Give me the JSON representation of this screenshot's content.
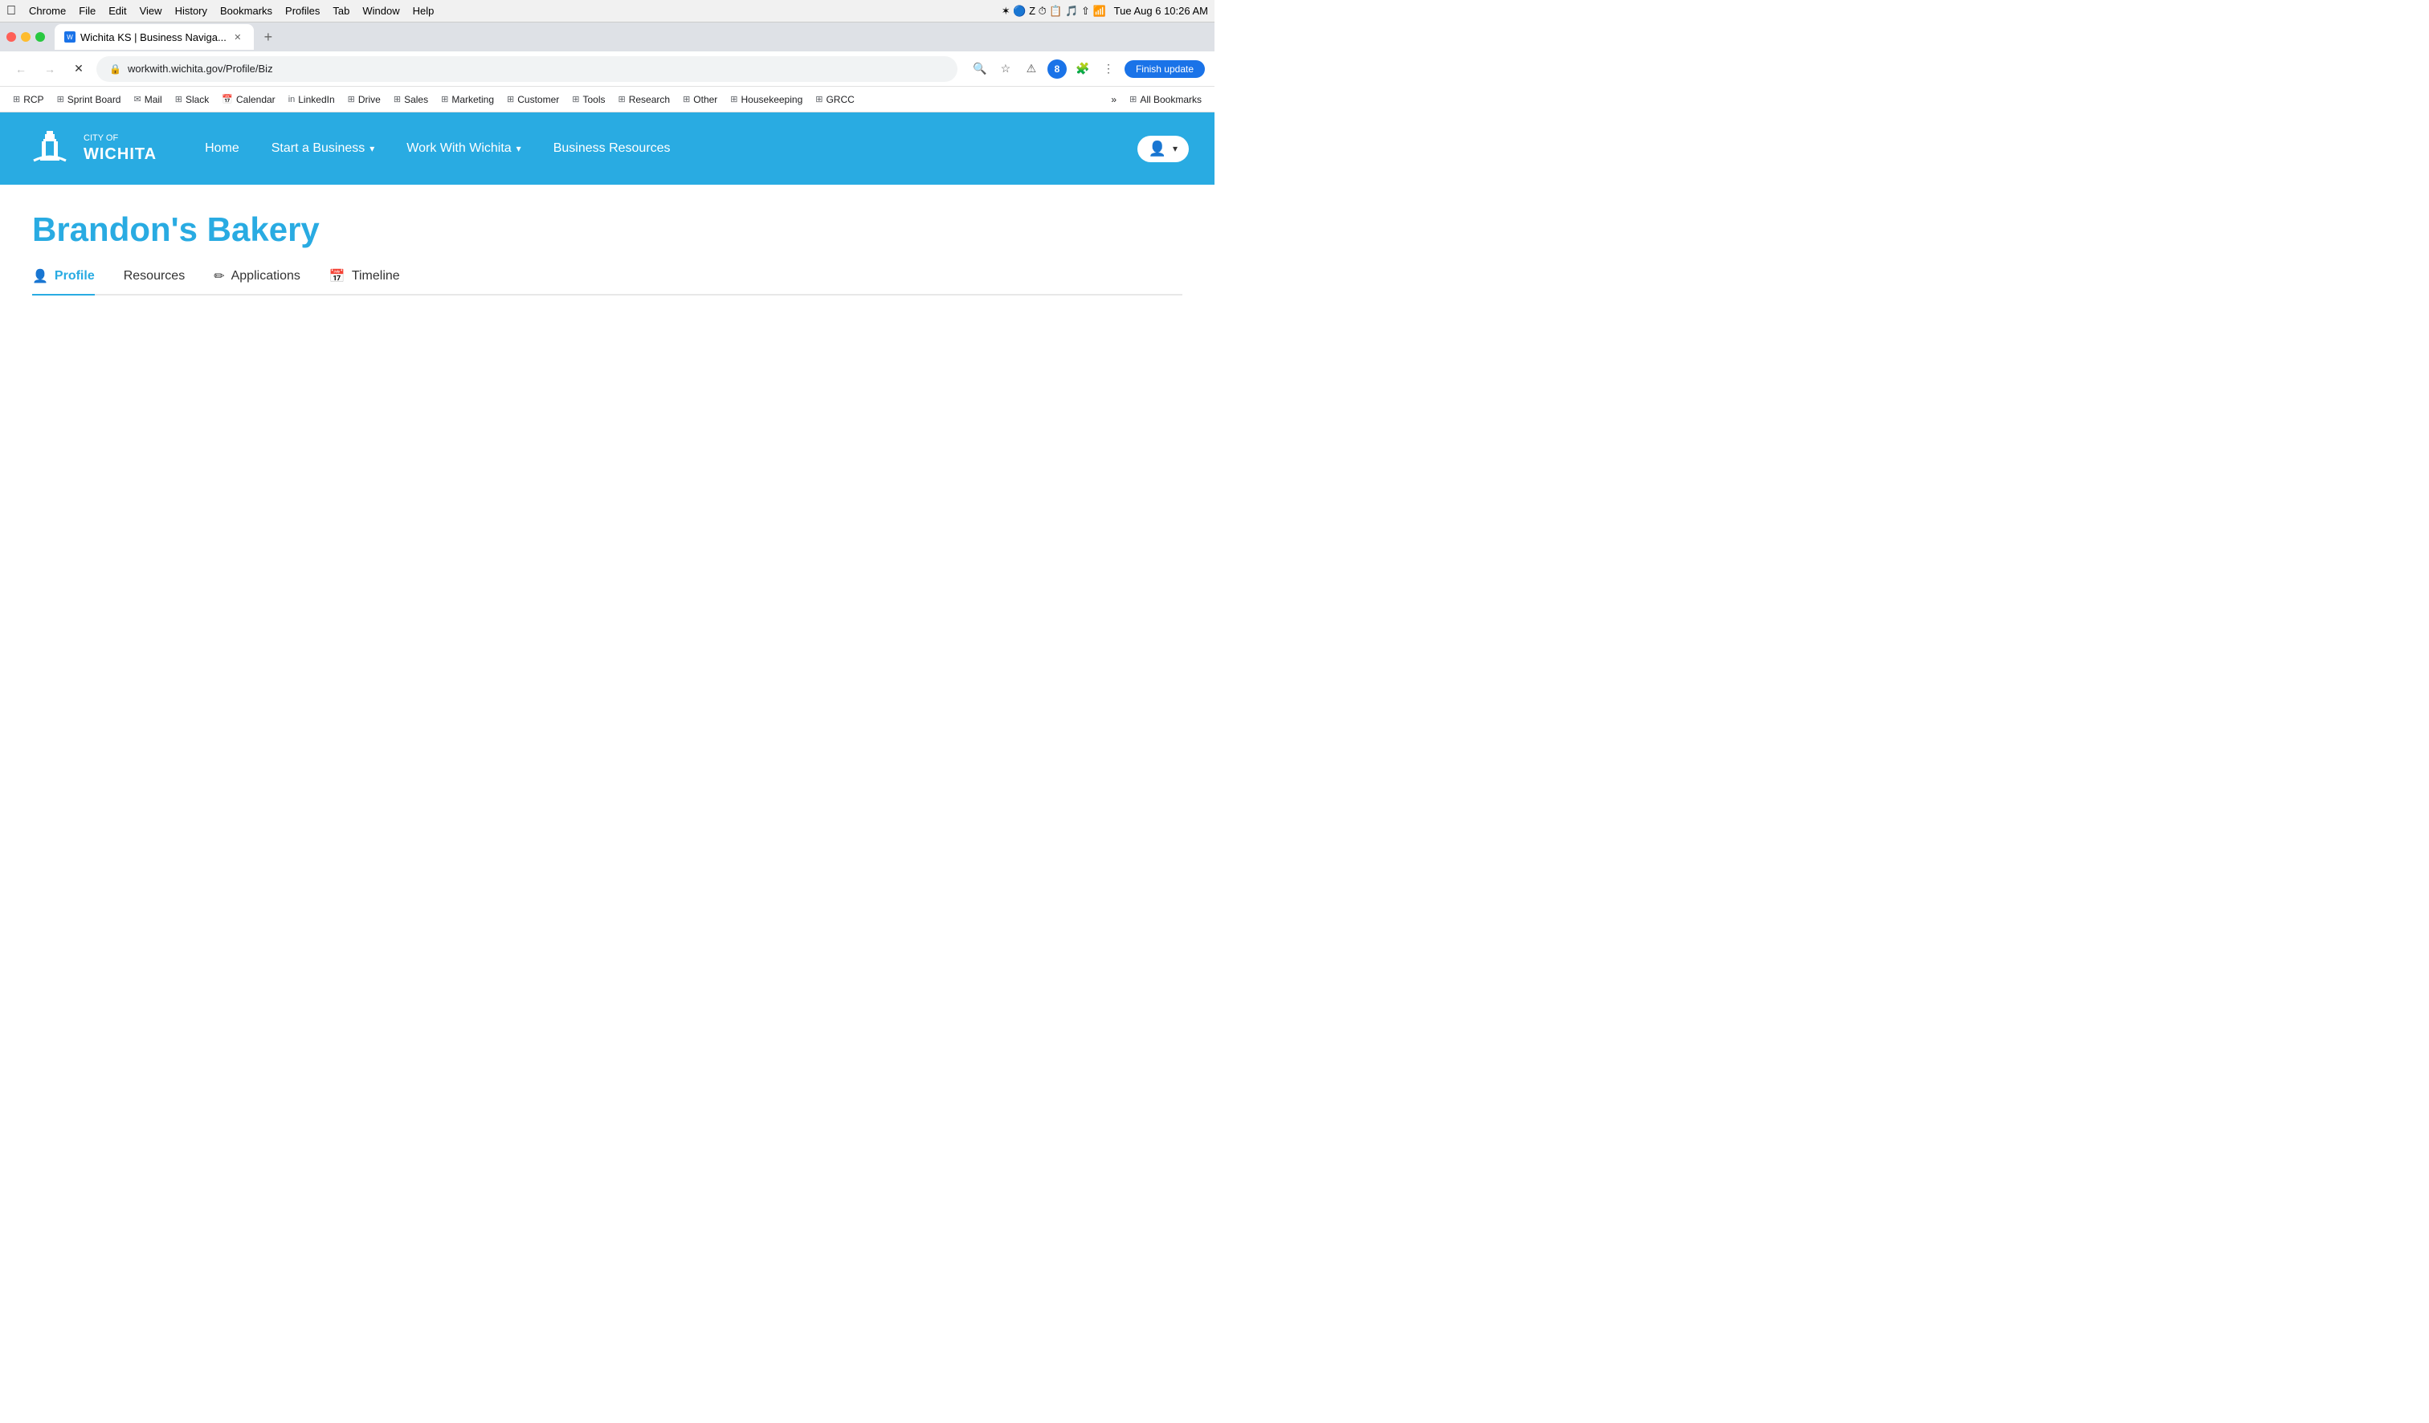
{
  "os": {
    "menubar": {
      "apple": "⌘",
      "items": [
        "Chrome",
        "File",
        "Edit",
        "View",
        "History",
        "Bookmarks",
        "Profiles",
        "Tab",
        "Window",
        "Help"
      ],
      "time": "Tue Aug 6  10:26 AM"
    }
  },
  "browser": {
    "tab": {
      "title": "Wichita KS | Business Naviga...",
      "url": "workwith.wichita.gov/Profile/Biz"
    },
    "finish_update": "Finish update",
    "bookmarks": [
      {
        "label": "RCP",
        "type": "folder"
      },
      {
        "label": "Sprint Board",
        "type": "folder"
      },
      {
        "label": "Mail",
        "type": "folder"
      },
      {
        "label": "Slack",
        "type": "folder"
      },
      {
        "label": "Calendar",
        "type": "folder"
      },
      {
        "label": "LinkedIn",
        "type": "folder"
      },
      {
        "label": "Drive",
        "type": "folder"
      },
      {
        "label": "Sales",
        "type": "folder"
      },
      {
        "label": "Marketing",
        "type": "folder"
      },
      {
        "label": "Customer",
        "type": "folder"
      },
      {
        "label": "Tools",
        "type": "folder"
      },
      {
        "label": "Research",
        "type": "folder"
      },
      {
        "label": "Other",
        "type": "folder"
      },
      {
        "label": "Housekeeping",
        "type": "folder"
      },
      {
        "label": "GRCC",
        "type": "folder"
      },
      {
        "label": "All Bookmarks",
        "type": "folder"
      }
    ]
  },
  "site": {
    "logo_city": "CITY OF",
    "logo_name": "WICHITA",
    "nav": [
      {
        "label": "Home",
        "has_dropdown": false
      },
      {
        "label": "Start a Business",
        "has_dropdown": true
      },
      {
        "label": "Work With Wichita",
        "has_dropdown": true
      },
      {
        "label": "Business Resources",
        "has_dropdown": false
      }
    ]
  },
  "page": {
    "business_name": "Brandon's Bakery",
    "tabs": [
      {
        "label": "Profile",
        "icon": "person",
        "active": true
      },
      {
        "label": "Resources",
        "icon": "",
        "active": false
      },
      {
        "label": "Applications",
        "icon": "pencil",
        "active": false
      },
      {
        "label": "Timeline",
        "icon": "calendar",
        "active": false
      }
    ]
  }
}
